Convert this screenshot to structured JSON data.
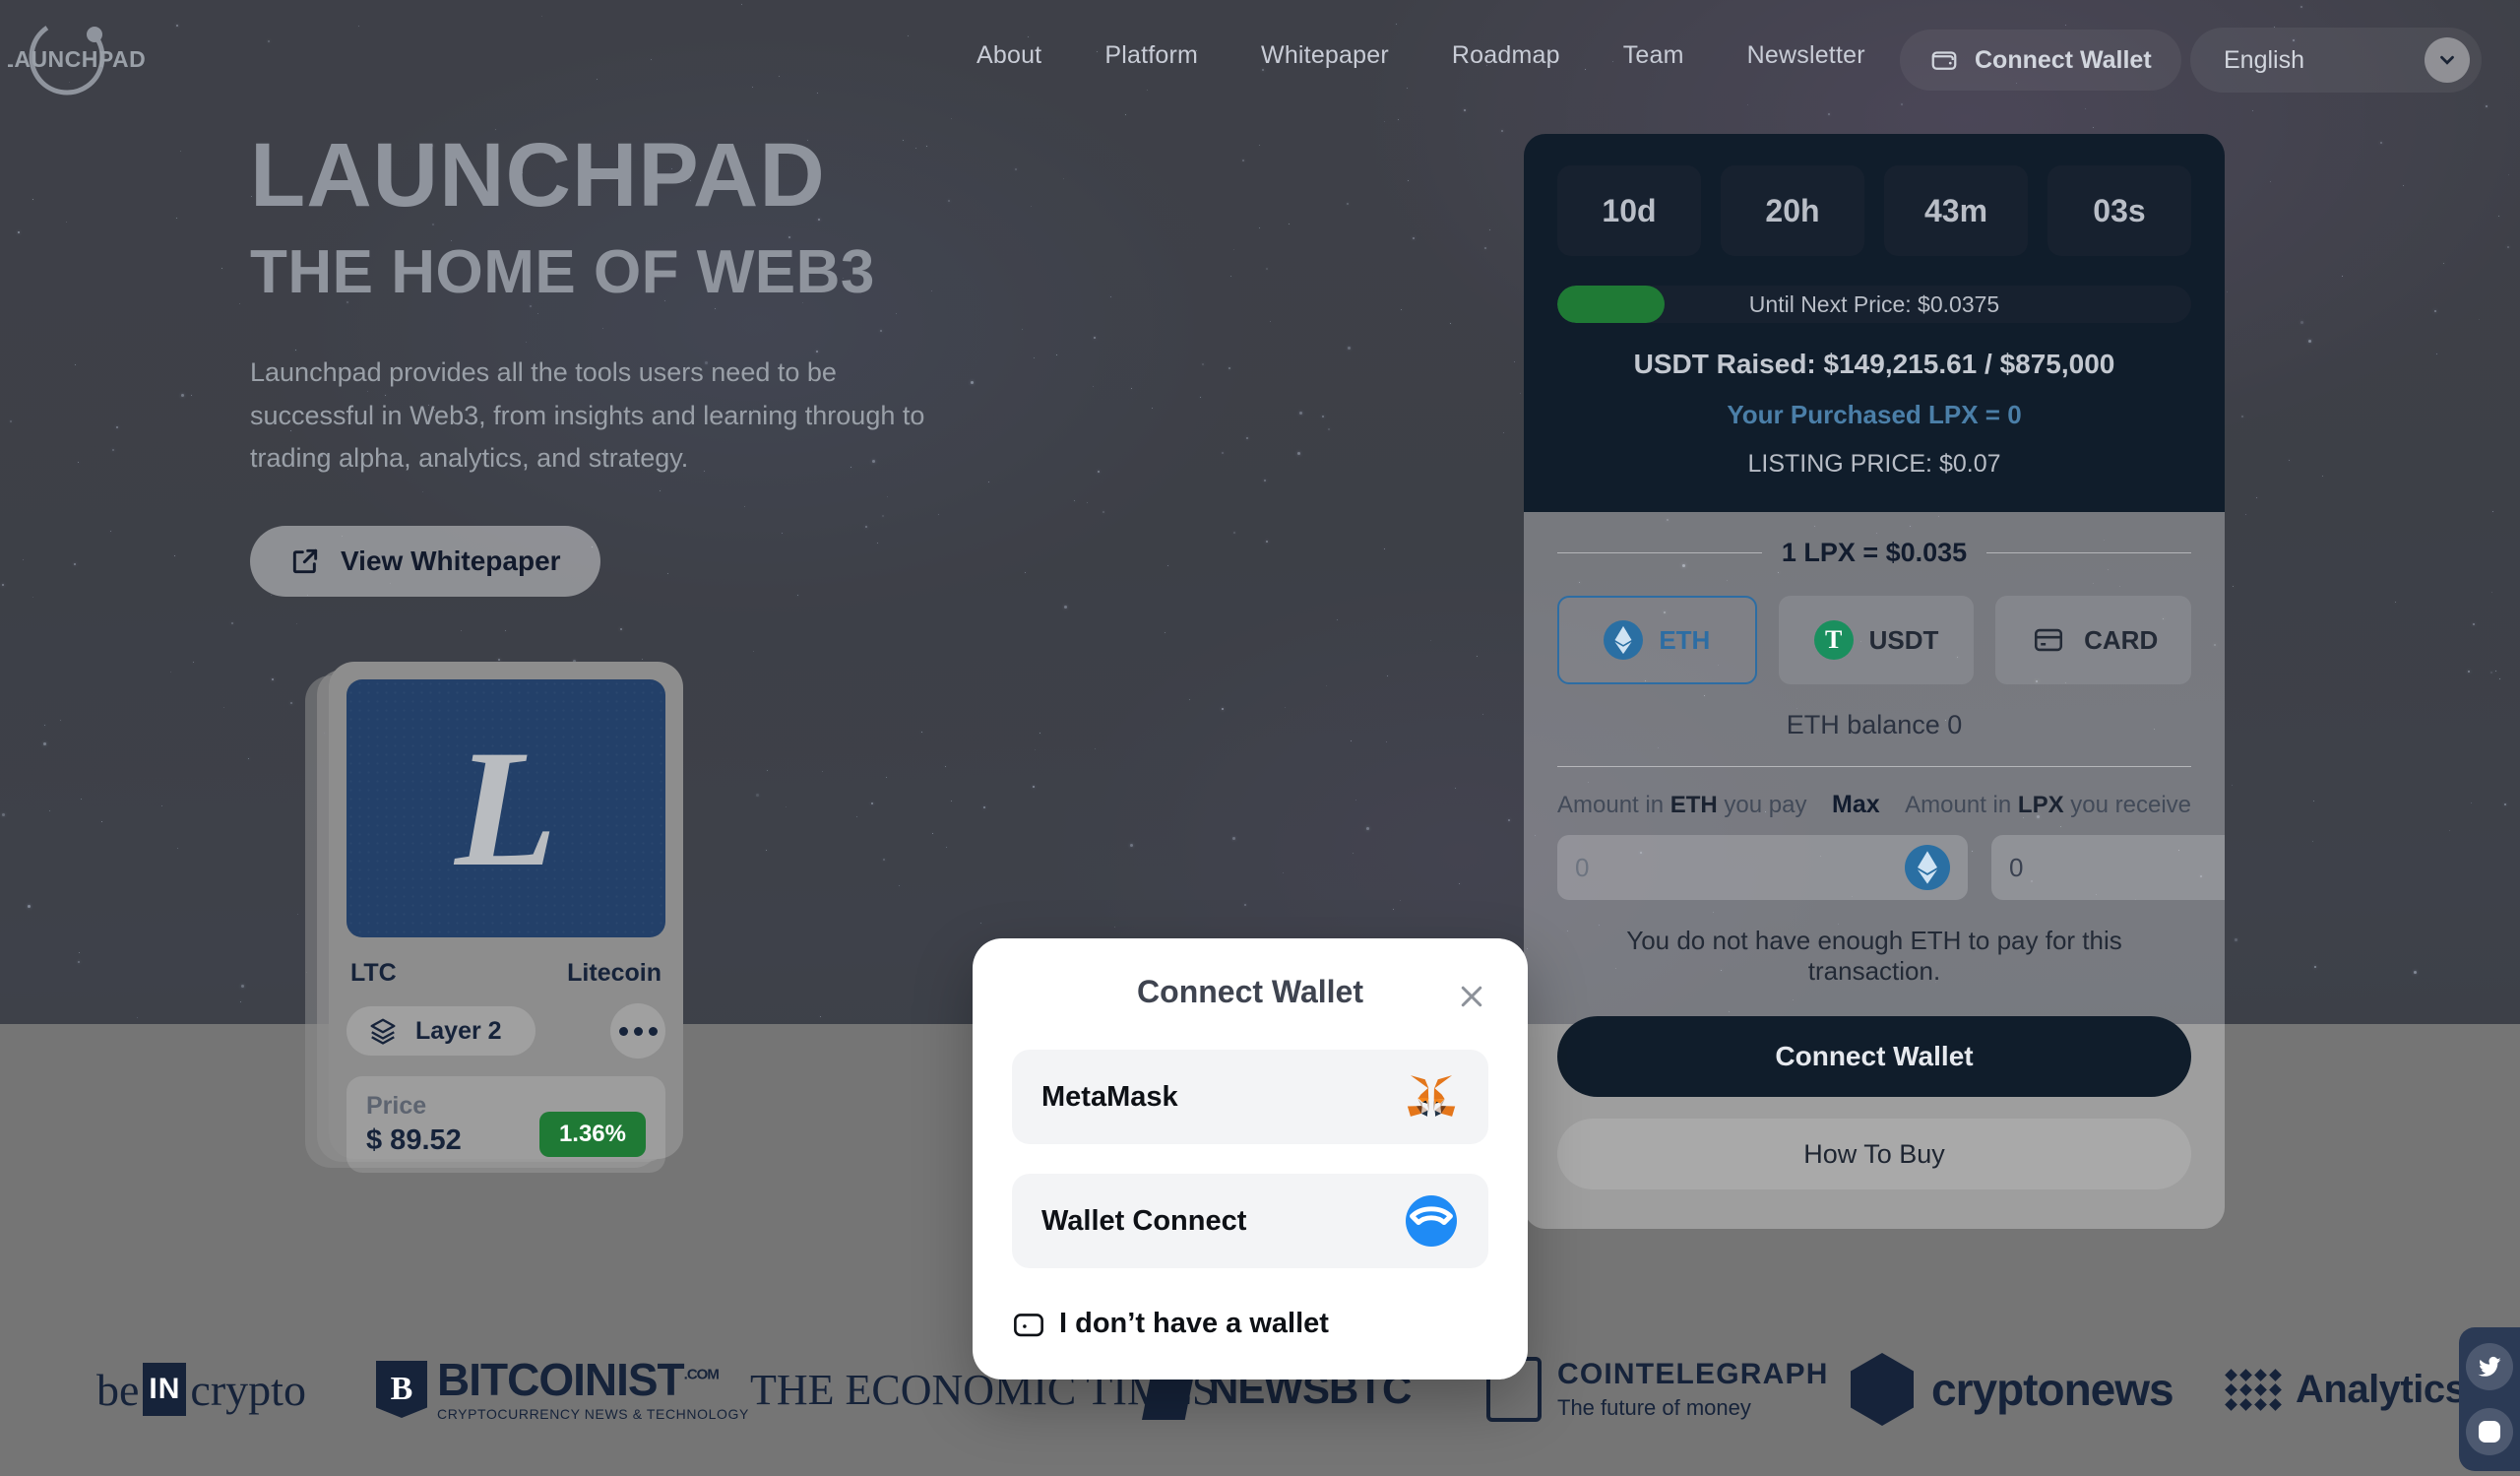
{
  "header": {
    "logo_text": "LAUNCHPAD",
    "nav": [
      {
        "label": "About"
      },
      {
        "label": "Platform"
      },
      {
        "label": "Whitepaper"
      },
      {
        "label": "Roadmap"
      },
      {
        "label": "Team"
      },
      {
        "label": "Newsletter"
      }
    ],
    "connect_wallet_label": "Connect Wallet",
    "language_value": "English"
  },
  "hero": {
    "title": "LAUNCHPAD",
    "subtitle": "THE HOME OF WEB3",
    "description": "Launchpad provides all the tools users need to be successful in Web3, from insights and learning through to trading alpha, analytics, and strategy.",
    "whitepaper_button": "View Whitepaper"
  },
  "coin_card": {
    "symbol_glyph": "L",
    "ticker": "LTC",
    "name": "Litecoin",
    "layer_label": "Layer 2",
    "price_label": "Price",
    "price_value": "$ 89.52",
    "change_badge": "1.36%"
  },
  "presale": {
    "timer": [
      {
        "value": "10d"
      },
      {
        "value": "20h"
      },
      {
        "value": "43m"
      },
      {
        "value": "03s"
      }
    ],
    "progress_text": "Until Next Price: $0.0375",
    "progress_percent": 17,
    "raised_text": "USDT Raised: $149,215.61 / $875,000",
    "purchased_text": "Your Purchased LPX = 0",
    "listing_text": "LISTING PRICE: $0.07",
    "rate_text": "1 LPX = $0.035",
    "payment_methods": [
      {
        "label": "ETH",
        "icon": "ethereum-icon",
        "selected": true
      },
      {
        "label": "USDT",
        "icon": "tether-icon",
        "selected": false
      },
      {
        "label": "CARD",
        "icon": "credit-card-icon",
        "selected": false
      }
    ],
    "balance_text": "ETH balance 0",
    "pay_label_prefix": "Amount in ",
    "pay_label_bold": "ETH",
    "pay_label_suffix": " you pay",
    "max_label": "Max",
    "receive_label_prefix": "Amount in ",
    "receive_label_bold": "LPX",
    "receive_label_suffix": " you receive",
    "pay_input_value": "",
    "pay_input_placeholder": "0",
    "receive_input_value": "0",
    "receive_input_placeholder": "0",
    "warning_text": "You do not have enough ETH to pay for this transaction.",
    "connect_button": "Connect Wallet",
    "how_to_buy_button": "How To Buy"
  },
  "modal": {
    "title": "Connect Wallet",
    "close_icon": "close-icon",
    "options": [
      {
        "name": "MetaMask",
        "icon": "metamask-fox-icon"
      },
      {
        "name": "Wallet Connect",
        "icon": "walletconnect-icon"
      }
    ],
    "no_wallet_label": "I don’t have a wallet"
  },
  "partners": [
    {
      "name": "beincrypto"
    },
    {
      "name": "BITCOINIST",
      "sub": "CRYPTOCURRENCY NEWS & TECHNOLOGY",
      "dotcom": ".COM"
    },
    {
      "name": "THE ECONOMIC TIMES"
    },
    {
      "name": "NEWSBTC"
    },
    {
      "name": "COINTELEGRAPH",
      "sub": "The future of money"
    },
    {
      "name": "cryptonews"
    },
    {
      "name": "Analytics Insight"
    }
  ],
  "social": [
    {
      "name": "twitter-icon"
    },
    {
      "name": "instagram-icon"
    }
  ],
  "colors": {
    "accent_green": "#1f7a35",
    "accent_blue": "#2d6da3",
    "panel_dark": "#101d2b",
    "walletconnect_blue": "#1f8bf5"
  }
}
